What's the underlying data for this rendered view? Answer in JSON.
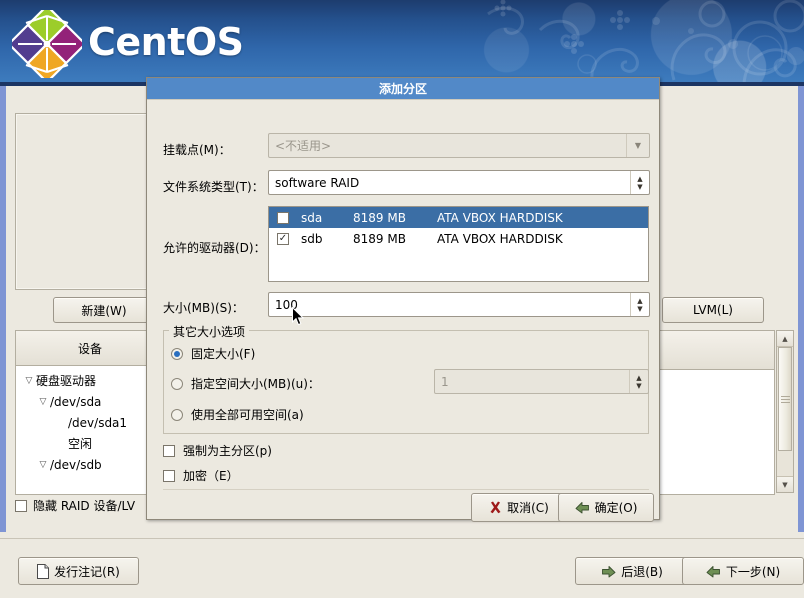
{
  "banner": {
    "brand": "CentOS",
    "logo_icon": "centos-logo-icon"
  },
  "main_window": {
    "new_button": "新建(W)",
    "lvm_button": "LVM(L)",
    "device_tree": {
      "header": "设备",
      "rows": [
        {
          "label": "硬盘驱动器",
          "indent": 0,
          "expander": "expanded"
        },
        {
          "label": "/dev/sda",
          "indent": 1,
          "expander": "expanded"
        },
        {
          "label": "/dev/sda1",
          "indent": 2,
          "expander": "none"
        },
        {
          "label": "空闲",
          "indent": 2,
          "expander": "none"
        },
        {
          "label": "/dev/sdb",
          "indent": 1,
          "expander": "expanded"
        }
      ]
    },
    "hide_raid_label": "隐藏 RAID 设备/LV",
    "hide_raid_checked": false,
    "scrollbar": {
      "up_arrow_icon": "triangle-up-icon",
      "down_arrow_icon": "triangle-down-icon"
    }
  },
  "dialog": {
    "title": "添加分区",
    "fields": {
      "mount_point_label": "挂载点(M)：",
      "mount_point_value": "<不适用>",
      "mount_point_disabled": true,
      "fs_type_label": "文件系统类型(T)：",
      "fs_type_value": "software RAID",
      "allowed_drives_label": "允许的驱动器(D)：",
      "size_label": "大小(MB)(S)：",
      "size_value": "100"
    },
    "drives": [
      {
        "name": "sda",
        "size": "8189 MB",
        "model": "ATA VBOX HARDDISK",
        "checked": false,
        "selected": true
      },
      {
        "name": "sdb",
        "size": "8189 MB",
        "model": "ATA VBOX HARDDISK",
        "checked": true,
        "selected": false
      }
    ],
    "size_options": {
      "group_title": "其它大小选项",
      "fixed": "固定大小(F)",
      "specify": "指定空间大小(MB)(u)：",
      "specify_value": "1",
      "specify_disabled": true,
      "fill_all": "使用全部可用空间(a)",
      "selected": "fixed"
    },
    "checkboxes": {
      "force_primary": "强制为主分区(p)",
      "force_primary_checked": false,
      "encrypt": "加密（E）",
      "encrypt_checked": false
    },
    "buttons": {
      "cancel": "取消(C)",
      "cancel_icon": "red-x-icon",
      "ok": "确定(O)",
      "ok_icon": "green-arrow-icon"
    }
  },
  "bottom_bar": {
    "release_notes": "发行注记(R)",
    "release_notes_icon": "document-icon",
    "back": "后退(B)",
    "back_icon": "arrow-left-icon",
    "next": "下一步(N)",
    "next_icon": "arrow-right-icon"
  },
  "colors": {
    "banner_blue": "#2f66aa",
    "dialog_title_blue": "#5289c8",
    "selection_blue": "#3b6ea5",
    "window_bg": "#ece9e0"
  }
}
